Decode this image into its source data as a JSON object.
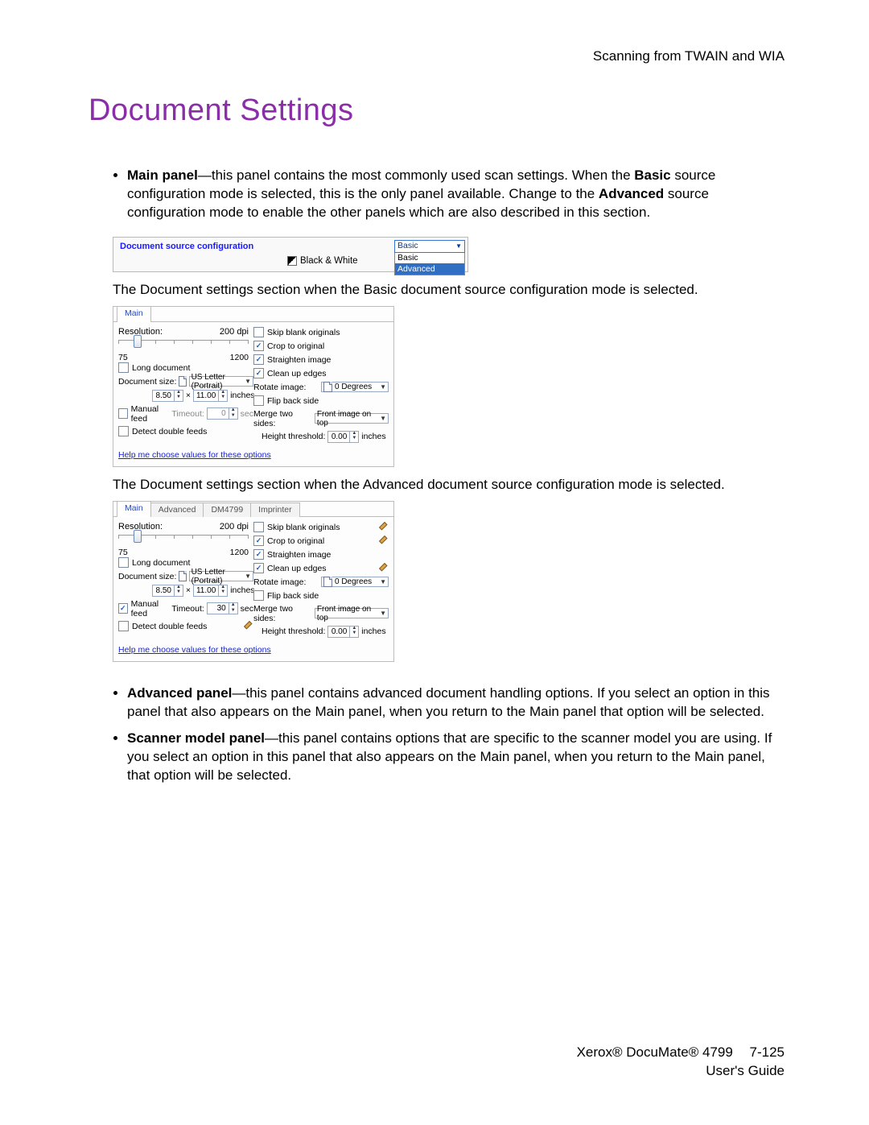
{
  "header": {
    "running": "Scanning from TWAIN and WIA"
  },
  "title": "Document Settings",
  "body": {
    "p_main": {
      "lead": "Main panel",
      "rest": "—this panel contains the most commonly used scan settings. When the ",
      "basic_bold": "Basic",
      "rest2": " source configuration mode is selected, this is the only panel available. Change to the ",
      "adv_bold": "Advanced",
      "rest3": " source configuration mode to enable the other panels which are also described in this section."
    },
    "caption_basic": "The Document settings section when the Basic document source configuration mode is selected.",
    "caption_adv": "The Document settings section when the Advanced document source configuration mode is selected.",
    "p_adv": {
      "lead": "Advanced panel",
      "rest": "—this panel contains advanced document handling options. If you select an option in this panel that also appears on the Main panel, when you return to the Main panel that option will be selected."
    },
    "p_scanner": {
      "lead": "Scanner model panel",
      "rest": "—this panel contains options that are specific to the scanner model you are using. If you select an option in this panel that also appears on the Main panel, when you return to the Main panel, that option will be selected."
    }
  },
  "fig_config": {
    "label": "Document source configuration",
    "bw": "Black & White",
    "dd_selected": "Basic",
    "dd_basic": "Basic",
    "dd_advanced": "Advanced"
  },
  "panel": {
    "tabs": {
      "main": "Main",
      "advanced": "Advanced",
      "dm": "DM4799",
      "imprinter": "Imprinter"
    },
    "res_label": "Resolution:",
    "res_val": "200 dpi",
    "res_min": "75",
    "res_max": "1200",
    "long_doc": "Long document",
    "doc_size": "Document size:",
    "doc_size_val": "US Letter (Portrait)",
    "w": "8.50",
    "times": "×",
    "h": "11.00",
    "units": "inches",
    "manual_feed": "Manual feed",
    "timeout": "Timeout:",
    "timeout_basic": "0",
    "timeout_adv": "30",
    "sec": "sec",
    "detect_df": "Detect double feeds",
    "skip_blank": "Skip blank originals",
    "crop_orig": "Crop to original",
    "straighten": "Straighten image",
    "cleanup": "Clean up edges",
    "rotate": "Rotate image:",
    "rotate_val": "0 Degrees",
    "flip_back": "Flip back side",
    "merge": "Merge two sides:",
    "merge_val": "Front image on top",
    "hthresh": "Height threshold:",
    "hthresh_v": "0.00",
    "hthresh_u": "inches",
    "help": "Help me choose values for these options"
  },
  "footer": {
    "product": "Xerox® DocuMate® 4799",
    "page": "7-125",
    "guide": "User's Guide"
  }
}
